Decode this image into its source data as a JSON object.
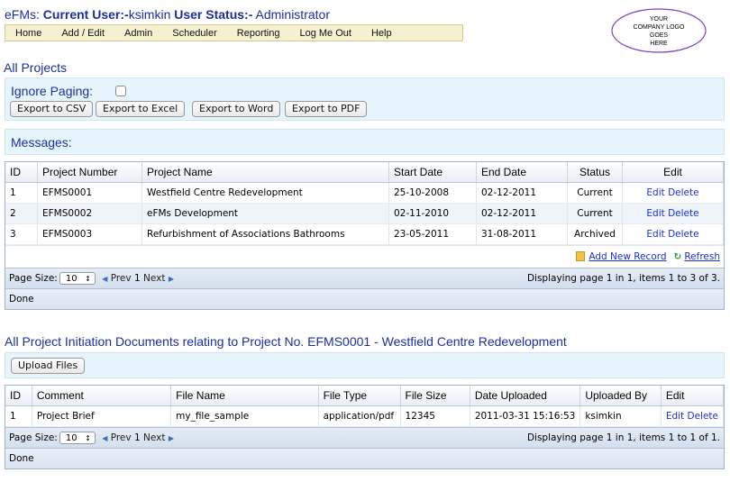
{
  "header": {
    "app_prefix": "eFMs: ",
    "user_label": "Current User:-",
    "user_name": "ksimkin",
    "status_label": " User Status:-",
    "status_value": " Administrator"
  },
  "nav": {
    "items": [
      "Home",
      "Add / Edit",
      "Admin",
      "Scheduler",
      "Reporting",
      "Log Me Out",
      "Help"
    ]
  },
  "logo": {
    "lines": [
      "YOUR",
      "COMPANY LOGO",
      "GOES",
      "HERE"
    ]
  },
  "projects": {
    "title": "All Projects",
    "ignore_paging_label": "Ignore Paging:",
    "export_buttons": [
      "Export to CSV",
      "Export to Excel",
      "Export to Word",
      "Export to PDF"
    ],
    "messages_label": "Messages:",
    "columns": [
      "ID",
      "Project Number",
      "Project Name",
      "Start Date",
      "End Date",
      "Status",
      "Edit"
    ],
    "rows": [
      {
        "id": "1",
        "number": "EFMS0001",
        "name": "Westfield Centre Redevelopment",
        "start": "25-10-2008",
        "end": "02-12-2011",
        "status": "Current"
      },
      {
        "id": "2",
        "number": "EFMS0002",
        "name": "eFMs Development",
        "start": "02-11-2010",
        "end": "02-12-2011",
        "status": "Current"
      },
      {
        "id": "3",
        "number": "EFMS0003",
        "name": "Refurbishment of Associations Bathrooms",
        "start": "23-05-2011",
        "end": "31-08-2011",
        "status": "Archived"
      }
    ],
    "edit_label": "Edit",
    "delete_label": "Delete",
    "add_record": "Add New Record",
    "refresh": "Refresh",
    "pager": {
      "page_size_label": "Page Size:",
      "page_size": "10",
      "prev": "Prev",
      "page": "1",
      "next": "Next",
      "summary": "Displaying page 1 in 1, items 1 to 3 of 3."
    },
    "status_text": "Done"
  },
  "documents": {
    "title": "All Project Initiation Documents relating to Project No. EFMS0001 - Westfield Centre Redevelopment",
    "upload_button": "Upload Files",
    "columns": [
      "ID",
      "Comment",
      "File Name",
      "File Type",
      "File Size",
      "Date Uploaded",
      "Uploaded By",
      "Edit"
    ],
    "rows": [
      {
        "id": "1",
        "comment": "Project Brief",
        "file_name": "my_file_sample",
        "file_type": "application/pdf",
        "file_size": "12345",
        "date": "2011-03-31 15:16:53",
        "by": "ksimkin"
      }
    ],
    "edit_label": "Edit",
    "delete_label": "Delete",
    "pager": {
      "page_size_label": "Page Size:",
      "page_size": "10",
      "prev": "Prev",
      "page": "1",
      "next": "Next",
      "summary": "Displaying page 1 in 1, items 1 to 1 of 1."
    },
    "status_text": "Done"
  },
  "colors": {
    "title_blue": "#1a2fa0",
    "link_blue": "#1b2fd4",
    "nav_bg": "#f5f0cf",
    "panel_bg": "#e6f4fb",
    "logo_border": "#7b3fc6"
  }
}
